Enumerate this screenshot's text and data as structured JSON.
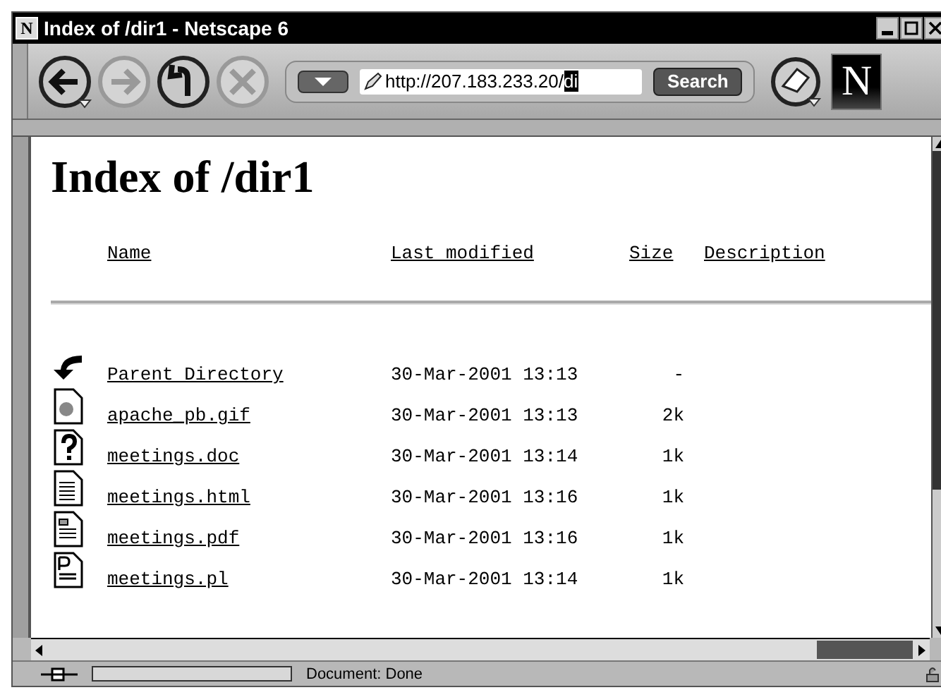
{
  "window": {
    "logo": "N",
    "title": "Index of /dir1 - Netscape 6"
  },
  "toolbar": {
    "nav_buttons": [
      {
        "kind": "back",
        "disabled": false
      },
      {
        "kind": "forward",
        "disabled": true
      },
      {
        "kind": "up",
        "disabled": false
      },
      {
        "kind": "stop",
        "disabled": true
      }
    ],
    "url": {
      "value": "http://207.183.233.20/",
      "selected_text": "di"
    },
    "search_button": "Search",
    "brand_logo": "N"
  },
  "page": {
    "heading": "Index of /dir1",
    "columns": [
      "Name",
      "Last modified",
      "Size",
      "Description"
    ],
    "rows": [
      {
        "kind": "back",
        "name": "Parent Directory",
        "modified": "30-Mar-2001 13:13",
        "size": "-"
      },
      {
        "kind": "image",
        "name": "apache_pb.gif",
        "modified": "30-Mar-2001 13:13",
        "size": "2k"
      },
      {
        "kind": "unknown",
        "name": "meetings.doc",
        "modified": "30-Mar-2001 13:14",
        "size": "1k"
      },
      {
        "kind": "text",
        "name": "meetings.html",
        "modified": "30-Mar-2001 13:16",
        "size": "1k"
      },
      {
        "kind": "layout",
        "name": "meetings.pdf",
        "modified": "30-Mar-2001 13:16",
        "size": "1k"
      },
      {
        "kind": "script",
        "name": "meetings.pl",
        "modified": "30-Mar-2001 13:14",
        "size": "1k"
      }
    ]
  },
  "status_bar": {
    "text": "Document: Done"
  }
}
